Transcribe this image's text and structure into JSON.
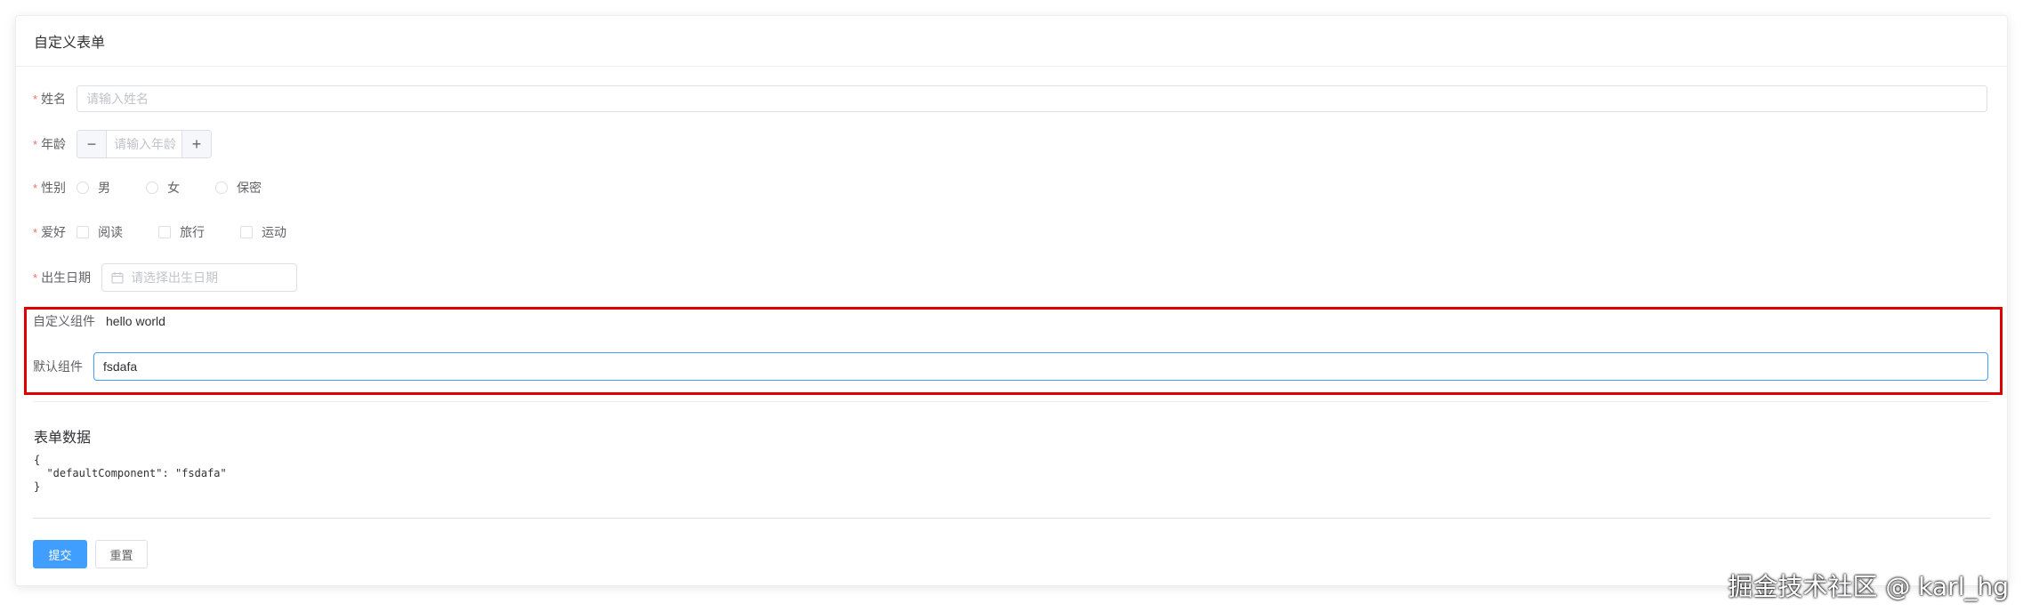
{
  "card": {
    "title": "自定义表单"
  },
  "form": {
    "required_mark": "*",
    "name": {
      "label": "姓名",
      "placeholder": "请输入姓名"
    },
    "age": {
      "label": "年龄",
      "placeholder": "请输入年龄",
      "minus": "−",
      "plus": "+"
    },
    "gender": {
      "label": "性别",
      "options": [
        "男",
        "女",
        "保密"
      ]
    },
    "hobby": {
      "label": "爱好",
      "options": [
        "阅读",
        "旅行",
        "运动"
      ]
    },
    "birthday": {
      "label": "出生日期",
      "placeholder": "请选择出生日期",
      "icon": "calendar-icon"
    },
    "custom_component": {
      "label": "自定义组件",
      "value": "hello world"
    },
    "default_component": {
      "label": "默认组件",
      "value": "fsdafa"
    }
  },
  "form_data": {
    "title": "表单数据",
    "json_text": "{\n  \"defaultComponent\": \"fsdafa\"\n}"
  },
  "actions": {
    "submit_label": "提交",
    "reset_label": "重置"
  },
  "watermark": "掘金技术社区 @ karl_hg",
  "colors": {
    "primary": "#409eff",
    "required": "#f56c6c",
    "highlight_border": "#e00000"
  }
}
